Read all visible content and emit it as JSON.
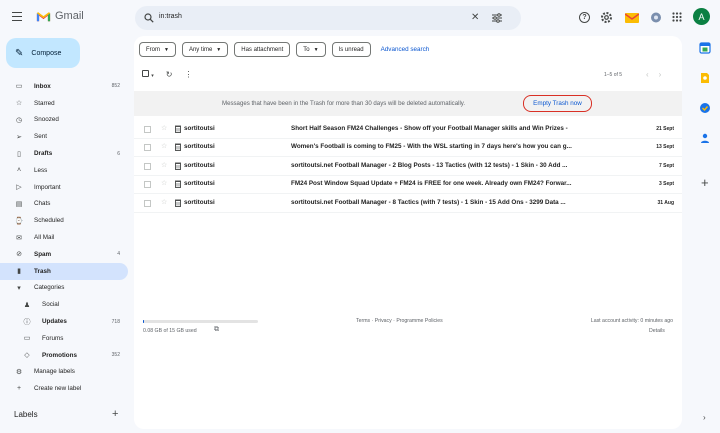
{
  "app": {
    "name": "Gmail"
  },
  "search": {
    "query": "in:trash"
  },
  "avatar": {
    "initial": "A",
    "color": "#0b8043"
  },
  "compose": {
    "label": "Compose"
  },
  "sidebar": {
    "items": [
      {
        "label": "Inbox",
        "count": "852",
        "icon": "inbox-icon",
        "glyph": "▭",
        "bold": true
      },
      {
        "label": "Starred",
        "count": "",
        "icon": "star-icon",
        "glyph": "☆"
      },
      {
        "label": "Snoozed",
        "count": "",
        "icon": "clock-icon",
        "glyph": "◷"
      },
      {
        "label": "Sent",
        "count": "",
        "icon": "send-icon",
        "glyph": "➢"
      },
      {
        "label": "Drafts",
        "count": "6",
        "icon": "draft-icon",
        "glyph": "▯",
        "bold": true
      },
      {
        "label": "Less",
        "count": "",
        "icon": "chevron-up-icon",
        "glyph": "˄"
      },
      {
        "label": "Important",
        "count": "",
        "icon": "important-icon",
        "glyph": "▷"
      },
      {
        "label": "Chats",
        "count": "",
        "icon": "chat-icon",
        "glyph": "▤"
      },
      {
        "label": "Scheduled",
        "count": "",
        "icon": "scheduled-icon",
        "glyph": "⌚"
      },
      {
        "label": "All Mail",
        "count": "",
        "icon": "all-mail-icon",
        "glyph": "✉"
      },
      {
        "label": "Spam",
        "count": "4",
        "icon": "spam-icon",
        "glyph": "⊘",
        "bold": true
      },
      {
        "label": "Trash",
        "count": "",
        "icon": "trash-icon",
        "glyph": "▮",
        "bold": true,
        "active": true
      },
      {
        "label": "Categories",
        "count": "",
        "icon": "label-icon",
        "glyph": "▾",
        "sub": false
      },
      {
        "label": "Social",
        "count": "",
        "icon": "people-icon",
        "glyph": "♟",
        "sub": true
      },
      {
        "label": "Updates",
        "count": "718",
        "icon": "info-icon",
        "glyph": "ⓘ",
        "sub": true,
        "bold": true
      },
      {
        "label": "Forums",
        "count": "",
        "icon": "forum-icon",
        "glyph": "▭",
        "sub": true
      },
      {
        "label": "Promotions",
        "count": "352",
        "icon": "tag-icon",
        "glyph": "◇",
        "sub": true,
        "bold": true
      },
      {
        "label": "Manage labels",
        "count": "",
        "icon": "gear-icon",
        "glyph": "⚙"
      },
      {
        "label": "Create new label",
        "count": "",
        "icon": "plus-icon",
        "glyph": "+"
      }
    ],
    "labels_header": "Labels"
  },
  "filters": {
    "chips": [
      {
        "label": "From",
        "caret": true
      },
      {
        "label": "Any time",
        "caret": true
      },
      {
        "label": "Has attachment",
        "caret": false
      },
      {
        "label": "To",
        "caret": true
      },
      {
        "label": "Is unread",
        "caret": false
      }
    ],
    "advanced": "Advanced search"
  },
  "toolbar": {
    "pager": "1–5 of 5"
  },
  "banner": {
    "text": "Messages that have been in the Trash for more than 30 days will be deleted automatically.",
    "button": "Empty Trash now",
    "highlight_color": "#d93025"
  },
  "messages": [
    {
      "sender": "sortitoutsi",
      "subject": "Short Half Season FM24 Challenges - Show off your Football Manager skills and Win Prizes -",
      "date": "21 Sept"
    },
    {
      "sender": "sortitoutsi",
      "subject": "Women's Football is coming to FM25 - With the WSL starting in 7 days here's how you can g...",
      "date": "13 Sept"
    },
    {
      "sender": "sortitoutsi",
      "subject": "sortitoutsi.net Football Manager - 2 Blog Posts - 13 Tactics (with 12 tests) - 1 Skin - 30 Add ...",
      "date": "7 Sept"
    },
    {
      "sender": "sortitoutsi",
      "subject": "FM24 Post Window Squad Update + FM24 is FREE for one week. Already own FM24? Forwar...",
      "date": "3 Sept"
    },
    {
      "sender": "sortitoutsi",
      "subject": "sortitoutsi.net Football Manager - 8 Tactics (with 7 tests) - 1 Skin - 15 Add Ons - 3299 Data ...",
      "date": "31 Aug"
    }
  ],
  "footer": {
    "storage": "0.08 GB of 15 GB used",
    "storage_fraction": 0.0053,
    "links": "Terms · Privacy · Programme Policies",
    "activity": "Last account activity: 0 minutes ago",
    "details": "Details"
  }
}
